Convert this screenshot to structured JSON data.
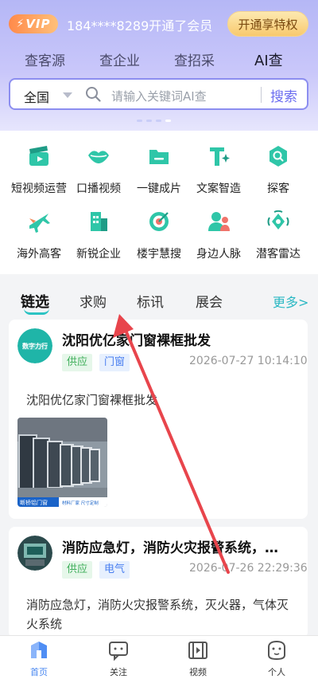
{
  "header": {
    "vip_label": "VIP",
    "member_text": "184****8289开通了会员",
    "open_button": "开通享特权",
    "tabs": [
      {
        "label": "查客源"
      },
      {
        "label": "查企业"
      },
      {
        "label": "查招采"
      },
      {
        "label": "AI查",
        "active": true
      }
    ]
  },
  "search": {
    "region": "全国",
    "placeholder": "请输入关键词AI查",
    "button": "搜索"
  },
  "carousel": {
    "count": 4,
    "active_index": 3
  },
  "quick_grid": [
    {
      "label": "短视频运营",
      "icon": "video-clapper-icon"
    },
    {
      "label": "口播视频",
      "icon": "lips-icon"
    },
    {
      "label": "一键成片",
      "icon": "folder-icon"
    },
    {
      "label": "文案智造",
      "icon": "text-sparkle-icon"
    },
    {
      "label": "探客",
      "icon": "hex-search-icon"
    },
    {
      "label": "海外高客",
      "icon": "airplane-icon"
    },
    {
      "label": "新锐企业",
      "icon": "building-icon"
    },
    {
      "label": "楼宇慧搜",
      "icon": "target-icon"
    },
    {
      "label": "身边人脉",
      "icon": "people-icon"
    },
    {
      "label": "潜客雷达",
      "icon": "radar-icon"
    }
  ],
  "feed_tabs": [
    {
      "label": "链选",
      "active": true
    },
    {
      "label": "求购"
    },
    {
      "label": "标讯"
    },
    {
      "label": "展会"
    }
  ],
  "more_label": "更多>",
  "cards": [
    {
      "title": "沈阳优亿家门窗裸框批发",
      "avatar_text": "数字力行",
      "tags": [
        "供应",
        "门窗"
      ],
      "time": "2026-07-27 10:14:10",
      "desc": "沈阳优亿家门窗裸框批发",
      "photo_caption_left": "断桥铝门窗",
      "photo_caption_right": "材料厂家 尺寸定制"
    },
    {
      "title": "消防应急灯，消防火灾报警系统，…",
      "tags": [
        "供应",
        "电气"
      ],
      "time": "2026-07-26 22:29:36",
      "desc": "消防应急灯，消防火灾报警系统，灭火器，气体灭火系统"
    }
  ],
  "bottom_nav": [
    {
      "label": "首页",
      "icon": "home-icon",
      "active": true
    },
    {
      "label": "关注",
      "icon": "follow-icon"
    },
    {
      "label": "视频",
      "icon": "film-icon"
    },
    {
      "label": "个人",
      "icon": "user-icon"
    }
  ],
  "colors": {
    "accent": "#6b6df0",
    "teal": "#2bc3c3",
    "header_top": "#b5b7f6",
    "annotation_arrow": "#e8454c"
  }
}
